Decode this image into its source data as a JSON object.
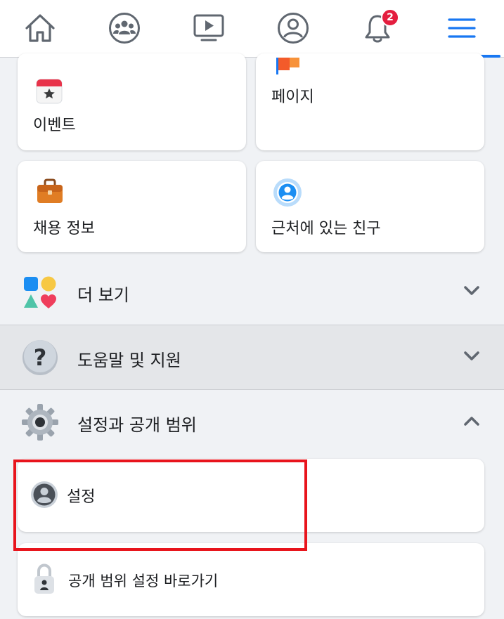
{
  "nav": {
    "items": [
      {
        "name": "home-icon"
      },
      {
        "name": "groups-icon"
      },
      {
        "name": "watch-icon"
      },
      {
        "name": "profile-icon"
      },
      {
        "name": "bell-icon"
      },
      {
        "name": "menu-icon"
      }
    ],
    "notification_count": "2",
    "active_color": "#1877f2"
  },
  "shortcuts": {
    "events": "이벤트",
    "pages": "페이지",
    "jobs": "채용 정보",
    "nearby_friends": "근처에 있는 친구"
  },
  "sections": {
    "see_more": "더 보기",
    "help_support": "도움말 및 지원",
    "settings_privacy": "설정과 공개 범위"
  },
  "settings_items": {
    "settings": "설정",
    "privacy_shortcuts": "공개 범위 설정 바로가기"
  },
  "colors": {
    "background": "#f0f2f5",
    "card": "#ffffff",
    "highlight": "#e8141c",
    "badge": "#e41e3f"
  }
}
